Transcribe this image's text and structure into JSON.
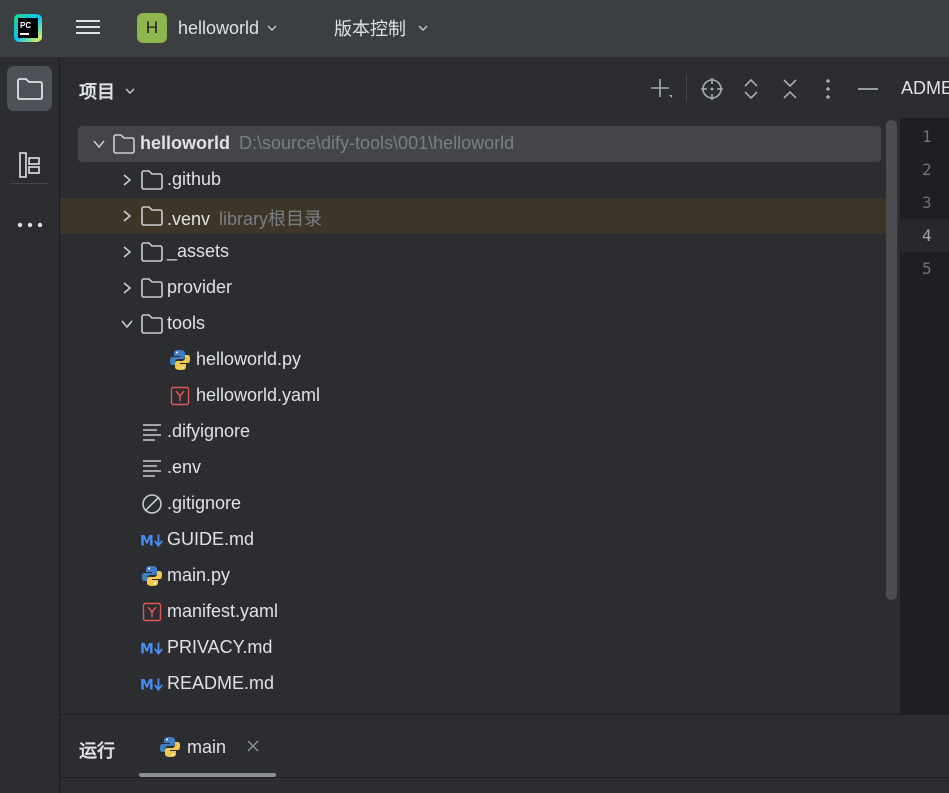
{
  "titlebar": {
    "app_logo_label": "PC",
    "project_initial": "H",
    "project_name": "helloworld",
    "vcs_label": "版本控制"
  },
  "toolstrip": {
    "items": [
      "project-folder",
      "structure",
      "more"
    ]
  },
  "panel": {
    "title": "项目"
  },
  "tree": {
    "rows": [
      {
        "name": "helloworld",
        "hint": "D:\\source\\dify-tools\\001\\helloworld",
        "type": "folder",
        "expanded": true,
        "depth": 0,
        "bold": true,
        "selected": true
      },
      {
        "name": ".github",
        "type": "folder",
        "expanded": false,
        "depth": 1
      },
      {
        "name": ".venv",
        "hint": "library根目录",
        "type": "folder",
        "expanded": false,
        "depth": 1,
        "highlight": true
      },
      {
        "name": "_assets",
        "type": "folder",
        "expanded": false,
        "depth": 1
      },
      {
        "name": "provider",
        "type": "folder",
        "expanded": false,
        "depth": 1
      },
      {
        "name": "tools",
        "type": "folder",
        "expanded": true,
        "depth": 1
      },
      {
        "name": "helloworld.py",
        "type": "python",
        "depth": 2
      },
      {
        "name": "helloworld.yaml",
        "type": "yaml",
        "depth": 2
      },
      {
        "name": ".difyignore",
        "type": "text",
        "depth": 1
      },
      {
        "name": ".env",
        "type": "text",
        "depth": 1
      },
      {
        "name": ".gitignore",
        "type": "ignore",
        "depth": 1
      },
      {
        "name": "GUIDE.md",
        "type": "markdown",
        "depth": 1
      },
      {
        "name": "main.py",
        "type": "python",
        "depth": 1
      },
      {
        "name": "manifest.yaml",
        "type": "yaml",
        "depth": 1
      },
      {
        "name": "PRIVACY.md",
        "type": "markdown",
        "depth": 1
      },
      {
        "name": "README.md",
        "type": "markdown",
        "depth": 1
      }
    ]
  },
  "editor": {
    "tab_label": "ADME",
    "line_numbers": [
      "1",
      "2",
      "3",
      "4",
      "5"
    ],
    "current_line": 4
  },
  "run_panel": {
    "title": "运行",
    "tab_name": "main"
  },
  "colors": {
    "background": "#2b2d30",
    "titlebar": "#3c3f41",
    "selection": "#43454a",
    "library_highlight": "#3d3528",
    "project_badge": "#8eb54e",
    "python_blue": "#3f7fc1",
    "python_yellow": "#f2c94c",
    "yaml_red": "#e05555",
    "markdown_blue": "#4b8cf5"
  }
}
